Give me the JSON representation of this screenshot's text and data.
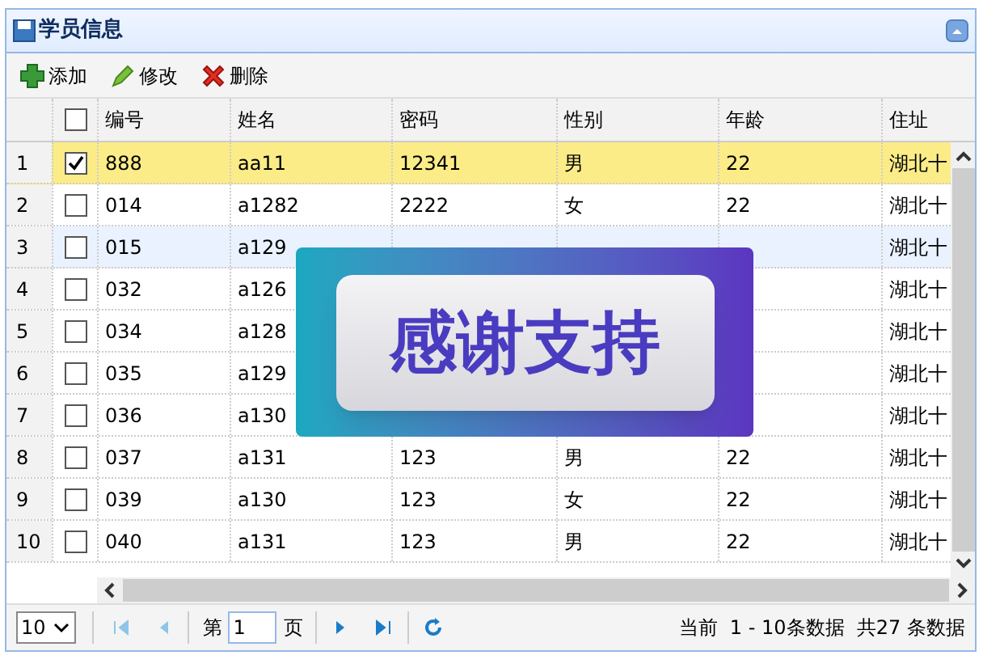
{
  "panel": {
    "title": "学员信息"
  },
  "toolbar": [
    {
      "label": "添加",
      "kind": "add"
    },
    {
      "label": "修改",
      "kind": "edit"
    },
    {
      "label": "删除",
      "kind": "delete"
    }
  ],
  "table": {
    "columns": [
      "编号",
      "姓名",
      "密码",
      "性别",
      "年龄",
      "住址"
    ],
    "header_checked": false,
    "rows": [
      {
        "number": "1",
        "checked": true,
        "selected": true,
        "highlighted": false,
        "cells": [
          "888",
          "aa11",
          "12341",
          "男",
          "22",
          "湖北十"
        ]
      },
      {
        "number": "2",
        "checked": false,
        "selected": false,
        "highlighted": false,
        "cells": [
          "014",
          "a1282",
          "2222",
          "女",
          "22",
          "湖北十"
        ]
      },
      {
        "number": "3",
        "checked": false,
        "selected": false,
        "highlighted": true,
        "cells": [
          "015",
          "a129",
          null,
          null,
          null,
          "湖北十"
        ]
      },
      {
        "number": "4",
        "checked": false,
        "selected": false,
        "highlighted": false,
        "cells": [
          "032",
          "a126",
          null,
          null,
          null,
          "湖北十"
        ]
      },
      {
        "number": "5",
        "checked": false,
        "selected": false,
        "highlighted": false,
        "cells": [
          "034",
          "a128",
          null,
          null,
          null,
          "湖北十"
        ]
      },
      {
        "number": "6",
        "checked": false,
        "selected": false,
        "highlighted": false,
        "cells": [
          "035",
          "a129",
          null,
          null,
          null,
          "湖北十"
        ]
      },
      {
        "number": "7",
        "checked": false,
        "selected": false,
        "highlighted": false,
        "cells": [
          "036",
          "a130",
          null,
          null,
          null,
          "湖北十"
        ]
      },
      {
        "number": "8",
        "checked": false,
        "selected": false,
        "highlighted": false,
        "cells": [
          "037",
          "a131",
          "123",
          "男",
          "22",
          "湖北十"
        ]
      },
      {
        "number": "9",
        "checked": false,
        "selected": false,
        "highlighted": false,
        "cells": [
          "039",
          "a130",
          "123",
          "女",
          "22",
          "湖北十"
        ]
      },
      {
        "number": "10",
        "checked": false,
        "selected": false,
        "highlighted": false,
        "cells": [
          "040",
          "a131",
          "123",
          "男",
          "22",
          "湖北十"
        ]
      }
    ]
  },
  "overlay": {
    "text": "感谢支持"
  },
  "pager": {
    "page_size": "10",
    "page_prefix": "第",
    "page": "1",
    "page_suffix": "页",
    "status": "当前  1 - 10条数据  共27 条数据"
  }
}
